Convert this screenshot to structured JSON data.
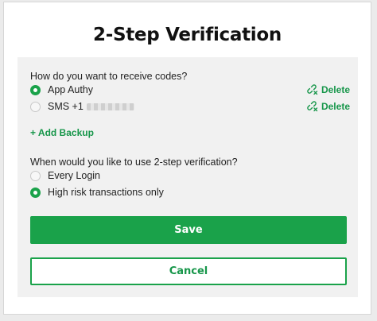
{
  "dialog": {
    "title": "2-Step Verification"
  },
  "receive_codes": {
    "question": "How do you want to receive codes?",
    "options": [
      {
        "label": "App Authy",
        "selected": true,
        "delete_label": "Delete"
      },
      {
        "label": "SMS +1",
        "selected": false,
        "delete_label": "Delete"
      }
    ],
    "add_backup_label": "+ Add Backup"
  },
  "use_when": {
    "question": "When would you like to use 2-step verification?",
    "options": [
      {
        "label": "Every Login",
        "selected": false
      },
      {
        "label": "High risk transactions only",
        "selected": true
      }
    ]
  },
  "actions": {
    "save_label": "Save",
    "cancel_label": "Cancel"
  },
  "colors": {
    "accent": "#1aa24a",
    "panel_bg": "#f1f1f1"
  },
  "icons": {
    "delete": "unlink-icon"
  }
}
